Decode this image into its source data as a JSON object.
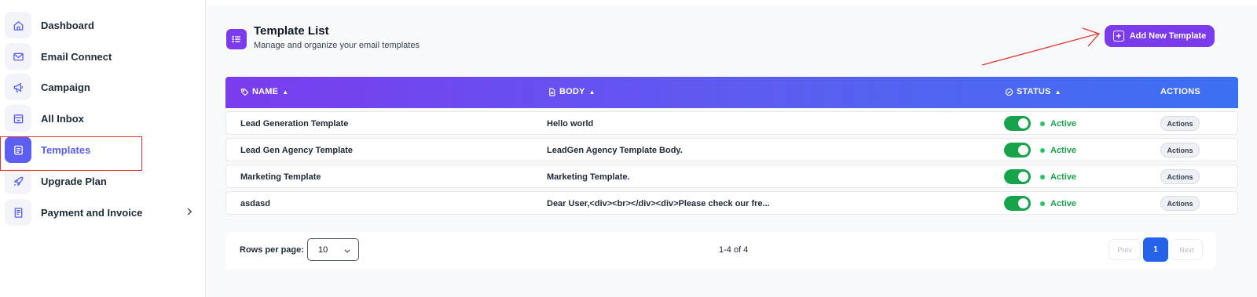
{
  "sidebar": {
    "items": [
      {
        "label": "Dashboard",
        "icon": "home-icon"
      },
      {
        "label": "Email Connect",
        "icon": "mail-icon"
      },
      {
        "label": "Campaign",
        "icon": "megaphone-icon"
      },
      {
        "label": "All Inbox",
        "icon": "inbox-icon"
      },
      {
        "label": "Templates",
        "icon": "template-icon",
        "active": true
      },
      {
        "label": "Upgrade Plan",
        "icon": "rocket-icon"
      },
      {
        "label": "Payment and Invoice",
        "icon": "invoice-icon",
        "has_submenu": true
      }
    ]
  },
  "header": {
    "title": "Template List",
    "subtitle": "Manage and organize your email templates",
    "add_button": "Add New Template"
  },
  "table": {
    "columns": {
      "name": "NAME",
      "body": "BODY",
      "status": "STATUS",
      "actions": "ACTIONS"
    },
    "rows": [
      {
        "name": "Lead Generation Template",
        "body": "Hello world",
        "status": "Active",
        "enabled": true,
        "action": "Actions"
      },
      {
        "name": "Lead Gen Agency Template",
        "body": "LeadGen Agency Template Body.",
        "status": "Active",
        "enabled": true,
        "action": "Actions"
      },
      {
        "name": "Marketing Template",
        "body": "Marketing Template.",
        "status": "Active",
        "enabled": true,
        "action": "Actions"
      },
      {
        "name": "asdasd",
        "body": "Dear User,<div><br></div><div>Please check our fre...",
        "status": "Active",
        "enabled": true,
        "action": "Actions"
      }
    ]
  },
  "pagination": {
    "rows_per_page_label": "Rows per page:",
    "rows_per_page": "10",
    "range": "1-4 of 4",
    "prev": "Prev",
    "current_page": "1",
    "next": "Next"
  },
  "colors": {
    "accent": "#7c3aed",
    "active_nav": "#5b5ef0",
    "status_green": "#16a34a",
    "page_blue": "#2563eb",
    "annotation_red": "#e3342f"
  }
}
